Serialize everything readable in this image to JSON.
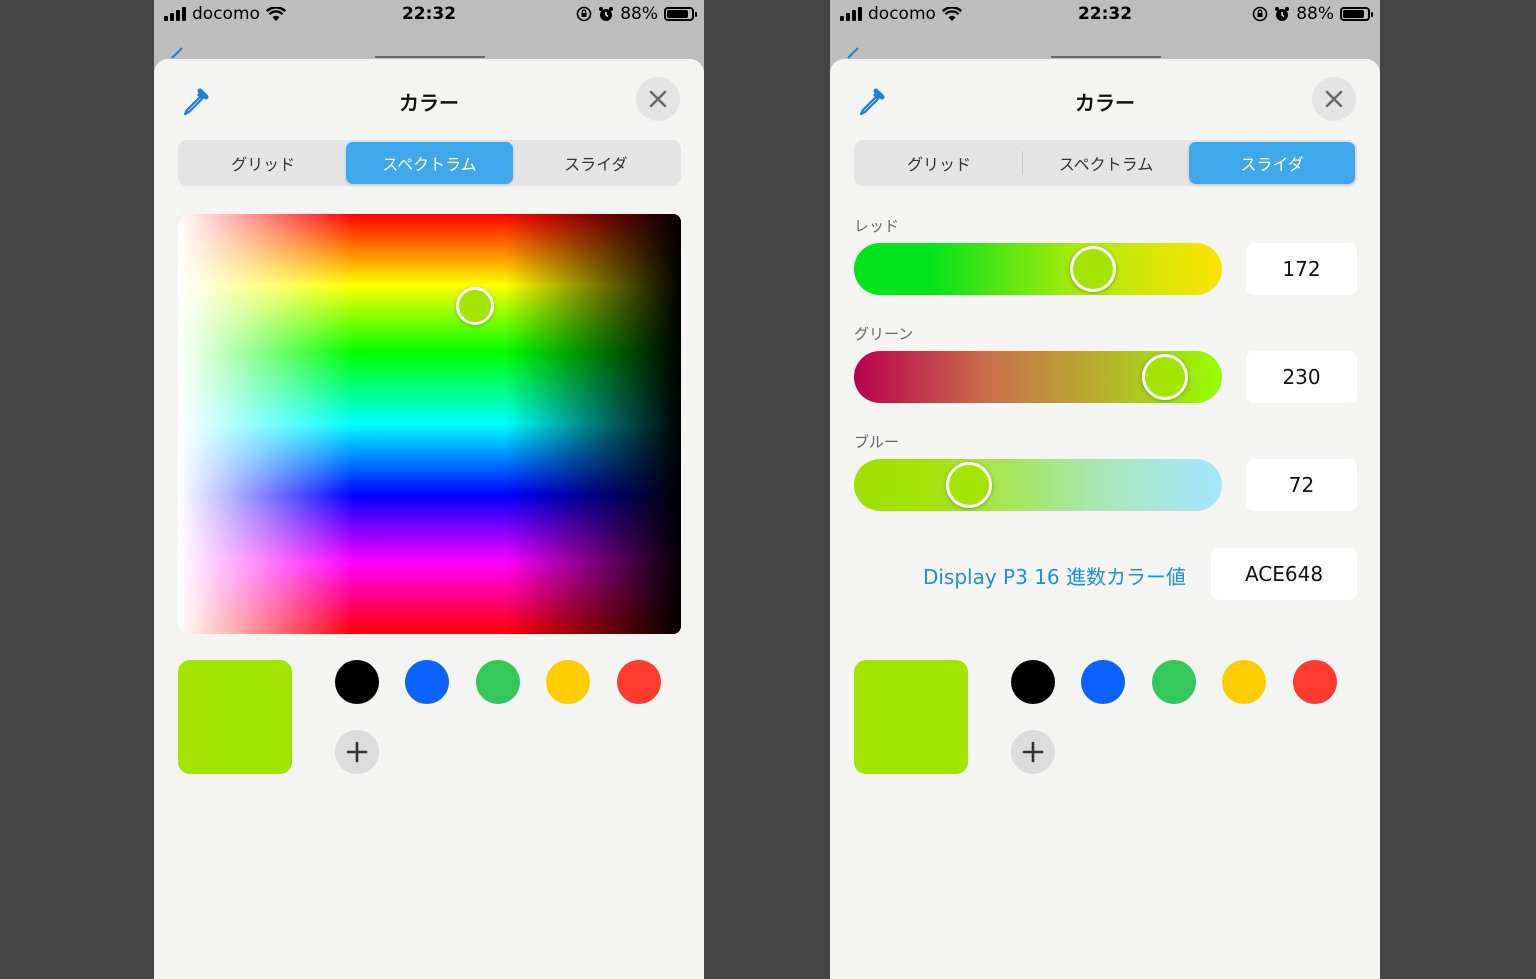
{
  "status": {
    "carrier": "docomo",
    "time": "22:32",
    "battery": "88%",
    "battery_level": 0.88
  },
  "sheet": {
    "title": "カラー"
  },
  "tabs": [
    "グリッド",
    "スペクトラム",
    "スライダ"
  ],
  "left": {
    "active_tab": "スペクトラム",
    "spectrum_selection": {
      "hue_fraction": 0.22,
      "brightness_fraction": 0.59
    }
  },
  "right": {
    "active_tab": "スライダ",
    "sliders": [
      {
        "label": "レッド",
        "value": "172"
      },
      {
        "label": "グリーン",
        "value": "230"
      },
      {
        "label": "ブルー",
        "value": "72"
      }
    ],
    "hex_label": "Display P3 16 進数カラー値",
    "hex_value": "ACE648"
  },
  "colors": {
    "current": "#a2e600",
    "accent": "#3ea8ea",
    "link": "#1a8fe3",
    "swatches": [
      "#000000",
      "#0a62ff",
      "#34c759",
      "#ffcc00",
      "#ff3b30"
    ]
  },
  "icons": {
    "eyedropper": "eyedropper-icon",
    "close": "close-icon",
    "add": "plus-icon"
  }
}
